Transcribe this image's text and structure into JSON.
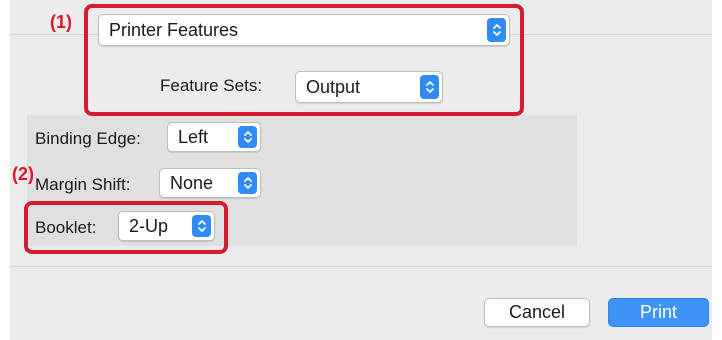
{
  "callouts": {
    "one": "(1)",
    "two": "(2)"
  },
  "dialog": {
    "panel_popup": "Printer Features",
    "feature_sets": {
      "label": "Feature Sets:",
      "value": "Output"
    },
    "binding_edge": {
      "label": "Binding Edge:",
      "value": "Left"
    },
    "margin_shift": {
      "label": "Margin Shift:",
      "value": "None"
    },
    "booklet": {
      "label": "Booklet:",
      "value": "2-Up"
    },
    "buttons": {
      "cancel": "Cancel",
      "print": "Print"
    }
  },
  "colors": {
    "callout": "#d71a2d",
    "accent": "#2f8cf4",
    "dialog_bg": "#ececec",
    "panel_bg": "#e0e0e0"
  },
  "icons": {
    "popup_arrows": "up-down-chevron-icon"
  }
}
